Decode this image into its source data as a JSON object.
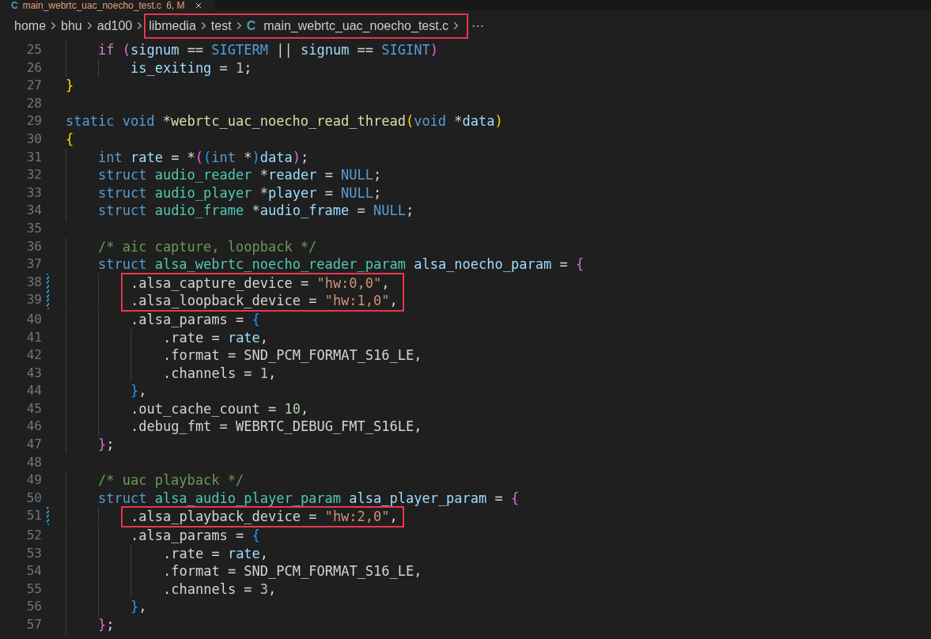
{
  "tab": {
    "icon_text": "C",
    "title": "main_webrtc_uac_noecho_test.c",
    "status": "6, M"
  },
  "breadcrumb": [
    {
      "label": "home",
      "highlighted": false
    },
    {
      "label": "bhu",
      "highlighted": false
    },
    {
      "label": "ad100",
      "highlighted": false
    },
    {
      "label": "libmedia",
      "highlighted": true
    },
    {
      "label": "test",
      "highlighted": true
    },
    {
      "label": "main_webrtc_uac_noecho_test.c",
      "icon_text": "C",
      "highlighted": true
    }
  ],
  "breadcrumb_more": "···",
  "lines": [
    {
      "number": "25",
      "modified": false,
      "highlighted": false,
      "tokens": [
        {
          "kind": "control",
          "text": "    if "
        },
        {
          "kind": "bracket2",
          "text": "("
        },
        {
          "kind": "variable",
          "text": "signum"
        },
        {
          "kind": "plain",
          "text": " == "
        },
        {
          "kind": "keyword",
          "text": "SIGTERM"
        },
        {
          "kind": "plain",
          "text": " || "
        },
        {
          "kind": "variable",
          "text": "signum"
        },
        {
          "kind": "plain",
          "text": " == "
        },
        {
          "kind": "keyword",
          "text": "SIGINT"
        },
        {
          "kind": "bracket2",
          "text": ")"
        }
      ]
    },
    {
      "number": "26",
      "modified": false,
      "highlighted": false,
      "tokens": [
        {
          "kind": "variable",
          "text": "        is_exiting"
        },
        {
          "kind": "plain",
          "text": " = "
        },
        {
          "kind": "number",
          "text": "1"
        },
        {
          "kind": "plain",
          "text": ";"
        }
      ]
    },
    {
      "number": "27",
      "modified": false,
      "highlighted": false,
      "tokens": [
        {
          "kind": "bracket1",
          "text": "}"
        }
      ]
    },
    {
      "number": "28",
      "modified": false,
      "highlighted": false
    },
    {
      "number": "29",
      "modified": false,
      "highlighted": false,
      "tokens": [
        {
          "kind": "keyword",
          "text": "static void "
        },
        {
          "kind": "plain",
          "text": "*"
        },
        {
          "kind": "function",
          "text": "webrtc_uac_noecho_read_thread"
        },
        {
          "kind": "bracket1",
          "text": "("
        },
        {
          "kind": "keyword",
          "text": "void "
        },
        {
          "kind": "plain",
          "text": "*"
        },
        {
          "kind": "variable",
          "text": "data"
        },
        {
          "kind": "bracket1",
          "text": ")"
        }
      ]
    },
    {
      "number": "30",
      "modified": false,
      "highlighted": false,
      "tokens": [
        {
          "kind": "bracket1",
          "text": "{"
        }
      ]
    },
    {
      "number": "31",
      "modified": false,
      "highlighted": false,
      "tokens": [
        {
          "kind": "keyword",
          "text": "    int "
        },
        {
          "kind": "variable",
          "text": "rate"
        },
        {
          "kind": "plain",
          "text": " = *"
        },
        {
          "kind": "bracket2",
          "text": "("
        },
        {
          "kind": "bracket3",
          "text": "("
        },
        {
          "kind": "keyword",
          "text": "int "
        },
        {
          "kind": "plain",
          "text": "*"
        },
        {
          "kind": "bracket3",
          "text": ")"
        },
        {
          "kind": "variable",
          "text": "data"
        },
        {
          "kind": "bracket2",
          "text": ")"
        },
        {
          "kind": "plain",
          "text": ";"
        }
      ]
    },
    {
      "number": "32",
      "modified": false,
      "highlighted": false,
      "tokens": [
        {
          "kind": "keyword",
          "text": "    struct "
        },
        {
          "kind": "type",
          "text": "audio_reader "
        },
        {
          "kind": "plain",
          "text": "*"
        },
        {
          "kind": "variable",
          "text": "reader"
        },
        {
          "kind": "plain",
          "text": " = "
        },
        {
          "kind": "keyword",
          "text": "NULL"
        },
        {
          "kind": "plain",
          "text": ";"
        }
      ]
    },
    {
      "number": "33",
      "modified": false,
      "highlighted": false,
      "tokens": [
        {
          "kind": "keyword",
          "text": "    struct "
        },
        {
          "kind": "type",
          "text": "audio_player "
        },
        {
          "kind": "plain",
          "text": "*"
        },
        {
          "kind": "variable",
          "text": "player"
        },
        {
          "kind": "plain",
          "text": " = "
        },
        {
          "kind": "keyword",
          "text": "NULL"
        },
        {
          "kind": "plain",
          "text": ";"
        }
      ]
    },
    {
      "number": "34",
      "modified": false,
      "highlighted": false,
      "tokens": [
        {
          "kind": "keyword",
          "text": "    struct "
        },
        {
          "kind": "type",
          "text": "audio_frame "
        },
        {
          "kind": "plain",
          "text": "*"
        },
        {
          "kind": "variable",
          "text": "audio_frame"
        },
        {
          "kind": "plain",
          "text": " = "
        },
        {
          "kind": "keyword",
          "text": "NULL"
        },
        {
          "kind": "plain",
          "text": ";"
        }
      ]
    },
    {
      "number": "35",
      "modified": false,
      "highlighted": false
    },
    {
      "number": "36",
      "modified": false,
      "highlighted": false,
      "tokens": [
        {
          "kind": "comment",
          "text": "    /* aic capture, loopback */"
        }
      ]
    },
    {
      "number": "37",
      "modified": false,
      "highlighted": false,
      "tokens": [
        {
          "kind": "keyword",
          "text": "    struct "
        },
        {
          "kind": "type",
          "text": "alsa_webrtc_noecho_reader_param "
        },
        {
          "kind": "variable",
          "text": "alsa_noecho_param"
        },
        {
          "kind": "plain",
          "text": " = "
        },
        {
          "kind": "bracket2",
          "text": "{"
        }
      ]
    },
    {
      "number": "38",
      "modified": true,
      "highlighted": true,
      "tokens": [
        {
          "kind": "plain",
          "text": "        .alsa_capture_device = "
        },
        {
          "kind": "string",
          "text": "\"hw:0,0\""
        },
        {
          "kind": "plain",
          "text": ","
        }
      ]
    },
    {
      "number": "39",
      "modified": true,
      "highlighted": true,
      "tokens": [
        {
          "kind": "plain",
          "text": "        .alsa_loopback_device = "
        },
        {
          "kind": "string",
          "text": "\"hw:1,0\""
        },
        {
          "kind": "plain",
          "text": ","
        }
      ]
    },
    {
      "number": "40",
      "modified": false,
      "highlighted": false,
      "tokens": [
        {
          "kind": "plain",
          "text": "        .alsa_params = "
        },
        {
          "kind": "bracket3",
          "text": "{"
        }
      ]
    },
    {
      "number": "41",
      "modified": false,
      "highlighted": false,
      "tokens": [
        {
          "kind": "plain",
          "text": "            .rate = "
        },
        {
          "kind": "variable",
          "text": "rate"
        },
        {
          "kind": "plain",
          "text": ","
        }
      ]
    },
    {
      "number": "42",
      "modified": false,
      "highlighted": false,
      "tokens": [
        {
          "kind": "plain",
          "text": "            .format = SND_PCM_FORMAT_S16_LE,"
        }
      ]
    },
    {
      "number": "43",
      "modified": false,
      "highlighted": false,
      "tokens": [
        {
          "kind": "plain",
          "text": "            .channels = "
        },
        {
          "kind": "number",
          "text": "1"
        },
        {
          "kind": "plain",
          "text": ","
        }
      ]
    },
    {
      "number": "44",
      "modified": false,
      "highlighted": false,
      "tokens": [
        {
          "kind": "bracket3",
          "text": "        }"
        },
        {
          "kind": "plain",
          "text": ","
        }
      ]
    },
    {
      "number": "45",
      "modified": false,
      "highlighted": false,
      "tokens": [
        {
          "kind": "plain",
          "text": "        .out_cache_count = "
        },
        {
          "kind": "number",
          "text": "10"
        },
        {
          "kind": "plain",
          "text": ","
        }
      ]
    },
    {
      "number": "46",
      "modified": false,
      "highlighted": false,
      "tokens": [
        {
          "kind": "plain",
          "text": "        .debug_fmt = WEBRTC_DEBUG_FMT_S16LE,"
        }
      ]
    },
    {
      "number": "47",
      "modified": false,
      "highlighted": false,
      "tokens": [
        {
          "kind": "bracket2",
          "text": "    }"
        },
        {
          "kind": "plain",
          "text": ";"
        }
      ]
    },
    {
      "number": "48",
      "modified": false,
      "highlighted": false
    },
    {
      "number": "49",
      "modified": false,
      "highlighted": false,
      "tokens": [
        {
          "kind": "comment",
          "text": "    /* uac playback */"
        }
      ]
    },
    {
      "number": "50",
      "modified": false,
      "highlighted": false,
      "tokens": [
        {
          "kind": "keyword",
          "text": "    struct "
        },
        {
          "kind": "type",
          "text": "alsa_audio_player_param "
        },
        {
          "kind": "variable",
          "text": "alsa_player_param"
        },
        {
          "kind": "plain",
          "text": " = "
        },
        {
          "kind": "bracket2",
          "text": "{"
        }
      ]
    },
    {
      "number": "51",
      "modified": true,
      "highlighted": true,
      "tokens": [
        {
          "kind": "plain",
          "text": "        .alsa_playback_device = "
        },
        {
          "kind": "string",
          "text": "\"hw:2,0\""
        },
        {
          "kind": "plain",
          "text": ","
        }
      ]
    },
    {
      "number": "52",
      "modified": false,
      "highlighted": false,
      "tokens": [
        {
          "kind": "plain",
          "text": "        .alsa_params = "
        },
        {
          "kind": "bracket3",
          "text": "{"
        }
      ]
    },
    {
      "number": "53",
      "modified": false,
      "highlighted": false,
      "tokens": [
        {
          "kind": "plain",
          "text": "            .rate = "
        },
        {
          "kind": "variable",
          "text": "rate"
        },
        {
          "kind": "plain",
          "text": ","
        }
      ]
    },
    {
      "number": "54",
      "modified": false,
      "highlighted": false,
      "tokens": [
        {
          "kind": "plain",
          "text": "            .format = SND_PCM_FORMAT_S16_LE,"
        }
      ]
    },
    {
      "number": "55",
      "modified": false,
      "highlighted": false,
      "tokens": [
        {
          "kind": "plain",
          "text": "            .channels = "
        },
        {
          "kind": "number",
          "text": "3"
        },
        {
          "kind": "plain",
          "text": ","
        }
      ]
    },
    {
      "number": "56",
      "modified": false,
      "highlighted": false,
      "tokens": [
        {
          "kind": "bracket3",
          "text": "        }"
        },
        {
          "kind": "plain",
          "text": ","
        }
      ]
    },
    {
      "number": "57",
      "modified": false,
      "highlighted": false,
      "tokens": [
        {
          "kind": "bracket2",
          "text": "    }"
        },
        {
          "kind": "plain",
          "text": ";"
        }
      ]
    }
  ]
}
